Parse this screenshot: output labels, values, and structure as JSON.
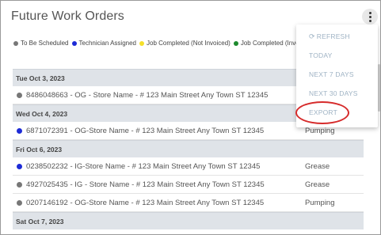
{
  "header": {
    "title": "Future Work Orders",
    "menu_icon": "kebab-menu-icon"
  },
  "legend": [
    {
      "label": "To Be Scheduled",
      "color": "#777777"
    },
    {
      "label": "Technician Assigned",
      "color": "#1d2bd6"
    },
    {
      "label": "Job Completed (Not Invoiced)",
      "color": "#f5e02a"
    },
    {
      "label": "Job Completed (Invoiced",
      "color": "#1e8a2e"
    }
  ],
  "groups": [
    {
      "date": "Tue Oct 3, 2023",
      "rows": [
        {
          "text": "8486048663 - OG - Store Name - #     123 Main Street  Any Town  ST  12345",
          "type": "",
          "status_color": "#777777"
        }
      ]
    },
    {
      "date": "Wed Oct 4, 2023",
      "rows": [
        {
          "text": "6871072391 - OG-Store Name -  #     123 Main Street  Any Town  ST  12345",
          "type": "Pumping",
          "status_color": "#1d2bd6"
        }
      ]
    },
    {
      "date": "Fri Oct 6, 2023",
      "rows": [
        {
          "text": "0238502232 - IG-Store Name - #       123 Main Street  Any Town  ST  12345",
          "type": "Grease",
          "status_color": "#1d2bd6"
        },
        {
          "text": "4927025435 - IG - Store Name - #     123 Main Street  Any Town  ST  12345",
          "type": "Grease",
          "status_color": "#777777"
        },
        {
          "text": "0207146192 - OG-Store Name -  #     123 Main Street  Any Town  ST  12345",
          "type": "Pumping",
          "status_color": "#777777"
        }
      ]
    },
    {
      "date": "Sat Oct 7, 2023",
      "rows": []
    }
  ],
  "menu": {
    "items": [
      "REFRESH",
      "TODAY",
      "NEXT 7 DAYS",
      "NEXT 30 DAYS",
      "EXPORT"
    ],
    "color": "#9fb3c4"
  },
  "annotation": {
    "color": "#d62b2b"
  }
}
